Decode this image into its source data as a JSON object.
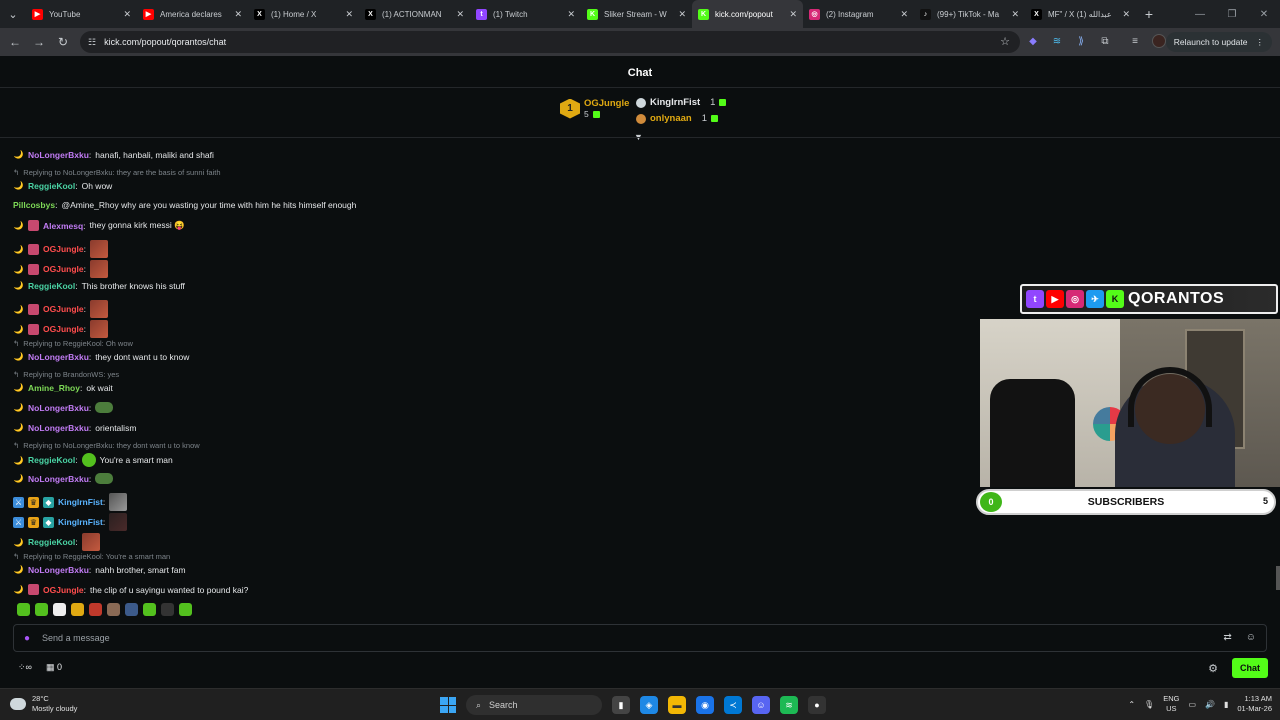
{
  "browser": {
    "tabs": [
      {
        "title": "YouTube",
        "icon": "youtube-icon",
        "color": "#ff0000",
        "glyph": "▶"
      },
      {
        "title": "America declares",
        "icon": "youtube-icon",
        "color": "#ff0000",
        "glyph": "▶"
      },
      {
        "title": "(1) Home / X",
        "icon": "x-icon",
        "color": "#000000",
        "glyph": "X"
      },
      {
        "title": "(1) ACTIONMAN",
        "icon": "x-icon",
        "color": "#000000",
        "glyph": "X"
      },
      {
        "title": "(1) Twitch",
        "icon": "twitch-icon",
        "color": "#9146ff",
        "glyph": "t"
      },
      {
        "title": "Sliker Stream - W",
        "icon": "kick-icon",
        "color": "#53fc18",
        "glyph": "K"
      },
      {
        "title": "kick.com/popout",
        "icon": "kick-icon",
        "color": "#53fc18",
        "glyph": "K",
        "active": true
      },
      {
        "title": "(2) Instagram",
        "icon": "instagram-icon",
        "color": "#d62976",
        "glyph": "◎"
      },
      {
        "title": "(99+) TikTok - Ma",
        "icon": "tiktok-icon",
        "color": "#111111",
        "glyph": "♪"
      },
      {
        "title": "MF\" / X عبدالله (1)",
        "icon": "x-icon",
        "color": "#000000",
        "glyph": "X"
      }
    ],
    "url": "kick.com/popout/qorantos/chat",
    "relaunch_label": "Relaunch to update"
  },
  "chat": {
    "header_title": "Chat",
    "leaderboard": {
      "first": {
        "rank": "1",
        "name": "OGJungle",
        "count": "5"
      },
      "second": {
        "name": "KingIrnFist",
        "count": "1"
      },
      "third": {
        "name": "onlynaan",
        "count": "1"
      }
    },
    "messages": [
      {
        "kind": "msg",
        "badges": [
          "moon"
        ],
        "user": "NoLongerBxku",
        "color": "#c27cf5",
        "text": "hanafi, hanbali, maliki and shafi"
      },
      {
        "kind": "reply",
        "text": "Replying to NoLongerBxku: they are the basis of sunni faith"
      },
      {
        "kind": "msg",
        "badges": [
          "moon"
        ],
        "user": "ReggieKool",
        "color": "#4ad3a4",
        "text": "Oh wow"
      },
      {
        "kind": "msg",
        "badges": [],
        "user": "Pillcosbys",
        "color": "#7ed957",
        "text": "@Amine_Rhoy why are you wasting your time with him he hits himself enough"
      },
      {
        "kind": "msg",
        "badges": [
          "moon",
          "gift"
        ],
        "user": "Alexmesq",
        "color": "#c27cf5",
        "text": "they gonna kirk messi 😝"
      },
      {
        "kind": "msg",
        "badges": [
          "moon",
          "gift"
        ],
        "user": "OGJungle",
        "color": "#ff4d4d",
        "text": "",
        "emote": "emote"
      },
      {
        "kind": "msg",
        "badges": [
          "moon",
          "gift"
        ],
        "user": "OGJungle",
        "color": "#ff4d4d",
        "text": "",
        "emote": "emote"
      },
      {
        "kind": "msg",
        "badges": [
          "moon"
        ],
        "user": "ReggieKool",
        "color": "#4ad3a4",
        "text": "This brother knows his stuff"
      },
      {
        "kind": "msg",
        "badges": [
          "moon",
          "gift"
        ],
        "user": "OGJungle",
        "color": "#ff4d4d",
        "text": "",
        "emote": "emote"
      },
      {
        "kind": "msg",
        "badges": [
          "moon",
          "gift"
        ],
        "user": "OGJungle",
        "color": "#ff4d4d",
        "text": "",
        "emote": "emote"
      },
      {
        "kind": "reply",
        "text": "Replying to ReggieKool: Oh wow"
      },
      {
        "kind": "msg",
        "badges": [
          "moon"
        ],
        "user": "NoLongerBxku",
        "color": "#c27cf5",
        "text": "they dont want u to know"
      },
      {
        "kind": "reply",
        "text": "Replying to BrandonWS: yes"
      },
      {
        "kind": "msg",
        "badges": [
          "moon"
        ],
        "user": "Amine_Rhoy",
        "color": "#7ed957",
        "text": "ok wait"
      },
      {
        "kind": "msg",
        "badges": [
          "moon"
        ],
        "user": "NoLongerBxku",
        "color": "#c27cf5",
        "text": "",
        "emote": "frog"
      },
      {
        "kind": "msg",
        "badges": [
          "moon"
        ],
        "user": "NoLongerBxku",
        "color": "#c27cf5",
        "text": "orientalism"
      },
      {
        "kind": "reply",
        "text": "Replying to NoLongerBxku: they dont want u to know"
      },
      {
        "kind": "msg",
        "badges": [
          "moon"
        ],
        "user": "ReggieKool",
        "color": "#4ad3a4",
        "text": "You're a smart man",
        "emote": "green"
      },
      {
        "kind": "msg",
        "badges": [
          "moon"
        ],
        "user": "NoLongerBxku",
        "color": "#c27cf5",
        "text": "",
        "emote": "frog"
      },
      {
        "kind": "msg",
        "badges": [
          "sword",
          "crown",
          "vip"
        ],
        "user": "KingIrnFist",
        "color": "#5ab4ff",
        "text": "",
        "emote": "grey"
      },
      {
        "kind": "msg",
        "badges": [
          "sword",
          "crown",
          "vip"
        ],
        "user": "KingIrnFist",
        "color": "#5ab4ff",
        "text": "",
        "emote": "dark"
      },
      {
        "kind": "msg",
        "badges": [
          "moon"
        ],
        "user": "ReggieKool",
        "color": "#4ad3a4",
        "text": "",
        "emote": "emote"
      },
      {
        "kind": "reply",
        "text": "Replying to ReggieKool: You're a smart man"
      },
      {
        "kind": "msg",
        "badges": [
          "moon"
        ],
        "user": "NoLongerBxku",
        "color": "#c27cf5",
        "text": "nahh brother, smart fam"
      },
      {
        "kind": "msg",
        "badges": [
          "moon",
          "gift"
        ],
        "user": "OGJungle",
        "color": "#ff4d4d",
        "text": "the clip of u sayingu wanted to pound kai?"
      }
    ],
    "composer_placeholder": "Send a message",
    "footer_count": "0",
    "chat_button_label": "Chat"
  },
  "overlay": {
    "brand_text": "QORANTOS",
    "sub_min": "0",
    "sub_label": "SUBSCRIBERS",
    "sub_max": "5"
  },
  "taskbar": {
    "temp": "28°C",
    "weather": "Mostly cloudy",
    "search_label": "Search",
    "lang_top": "ENG",
    "lang_bottom": "US",
    "time": "1:13 AM",
    "date": "01-Mar-26"
  }
}
